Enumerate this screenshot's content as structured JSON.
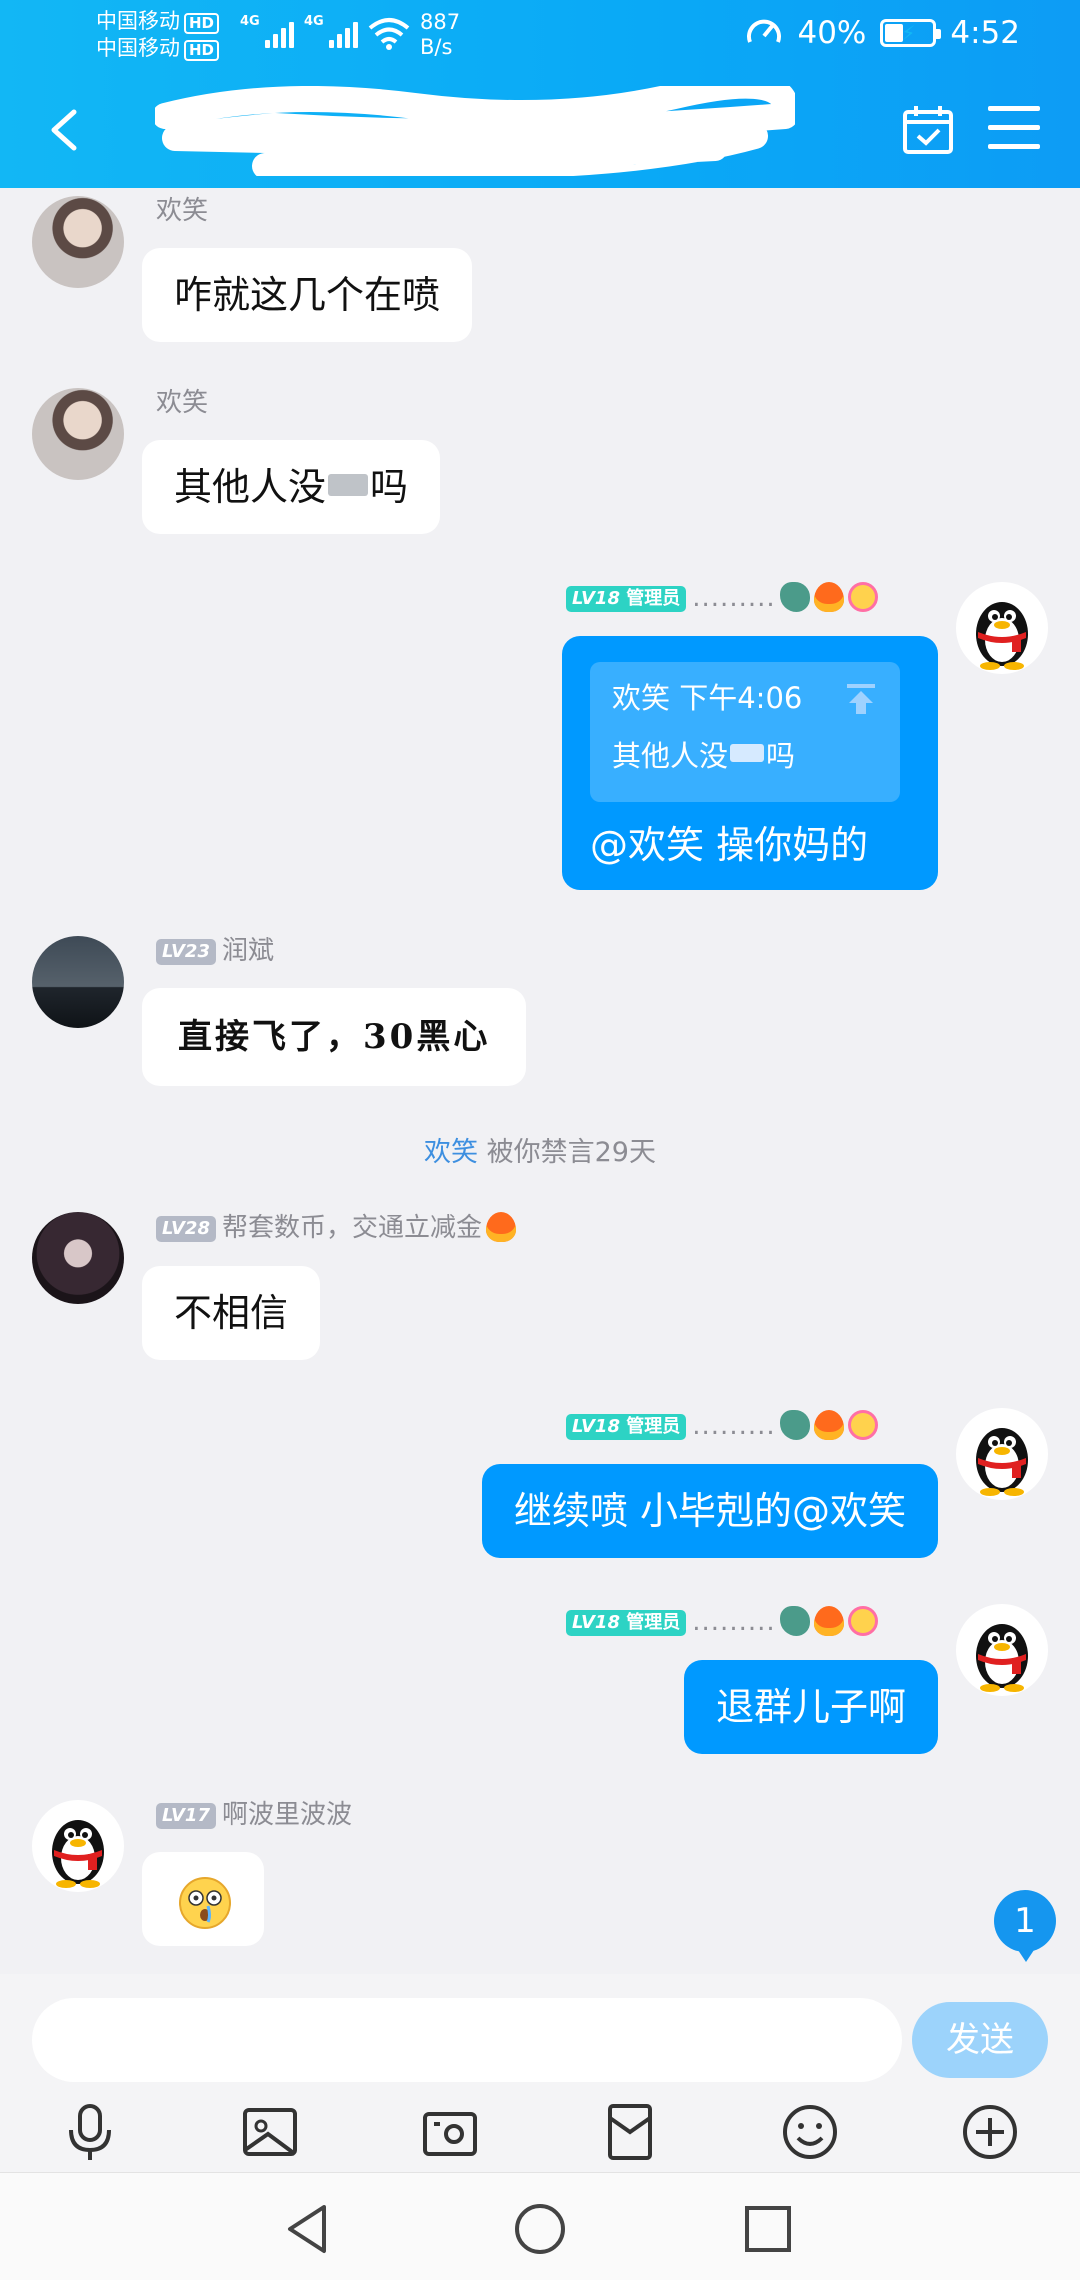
{
  "status_bar": {
    "carrier1": "中国移动",
    "carrier2": "中国移动",
    "hd": "HD",
    "net": "4G",
    "speed_value": "887",
    "speed_unit": "B/s",
    "battery": "40%",
    "battery_level": 0.4,
    "time": "4:52"
  },
  "header": {
    "title_redacted": true
  },
  "messages": [
    {
      "sender": "欢笑",
      "text": "咋就这几个在喷"
    },
    {
      "sender": "欢笑",
      "text_before": "其他人没",
      "text_after": "吗"
    },
    {
      "level": "LV18",
      "role": "管理员",
      "quote": {
        "sender": "欢笑",
        "time": "下午4:06",
        "text_before": "其他人没",
        "text_after": "吗"
      },
      "text": "@欢笑 操你妈的"
    },
    {
      "level": "LV23",
      "sender": "润斌",
      "text": "直接飞了，30黑心"
    },
    {
      "level": "LV28",
      "sender": "帮套数币，交通立减金",
      "text": "不相信"
    },
    {
      "level": "LV18",
      "role": "管理员",
      "text": "继续喷 小毕剋的@欢笑"
    },
    {
      "level": "LV18",
      "role": "管理员",
      "text": "退群儿子啊"
    },
    {
      "level": "LV17",
      "sender": "啊波里波波",
      "sticker": "astonished-face"
    }
  ],
  "system_notice": {
    "user": "欢笑",
    "text": "被你禁言29天"
  },
  "unread_count": "1",
  "composer": {
    "placeholder": "",
    "send_label": "发送"
  },
  "toolbar_icons": [
    "microphone-icon",
    "photo-icon",
    "camera-icon",
    "red-packet-icon",
    "emoji-icon",
    "plus-icon"
  ],
  "system_nav_icons": [
    "back-triangle-icon",
    "home-circle-icon",
    "recents-square-icon"
  ],
  "colors": {
    "header": "#12b7f5",
    "bubble_out": "#0099ff",
    "send_button": "#9cd3fb",
    "admin_badge": "#2dd3c4",
    "level_badge": "#b4b9c6"
  }
}
